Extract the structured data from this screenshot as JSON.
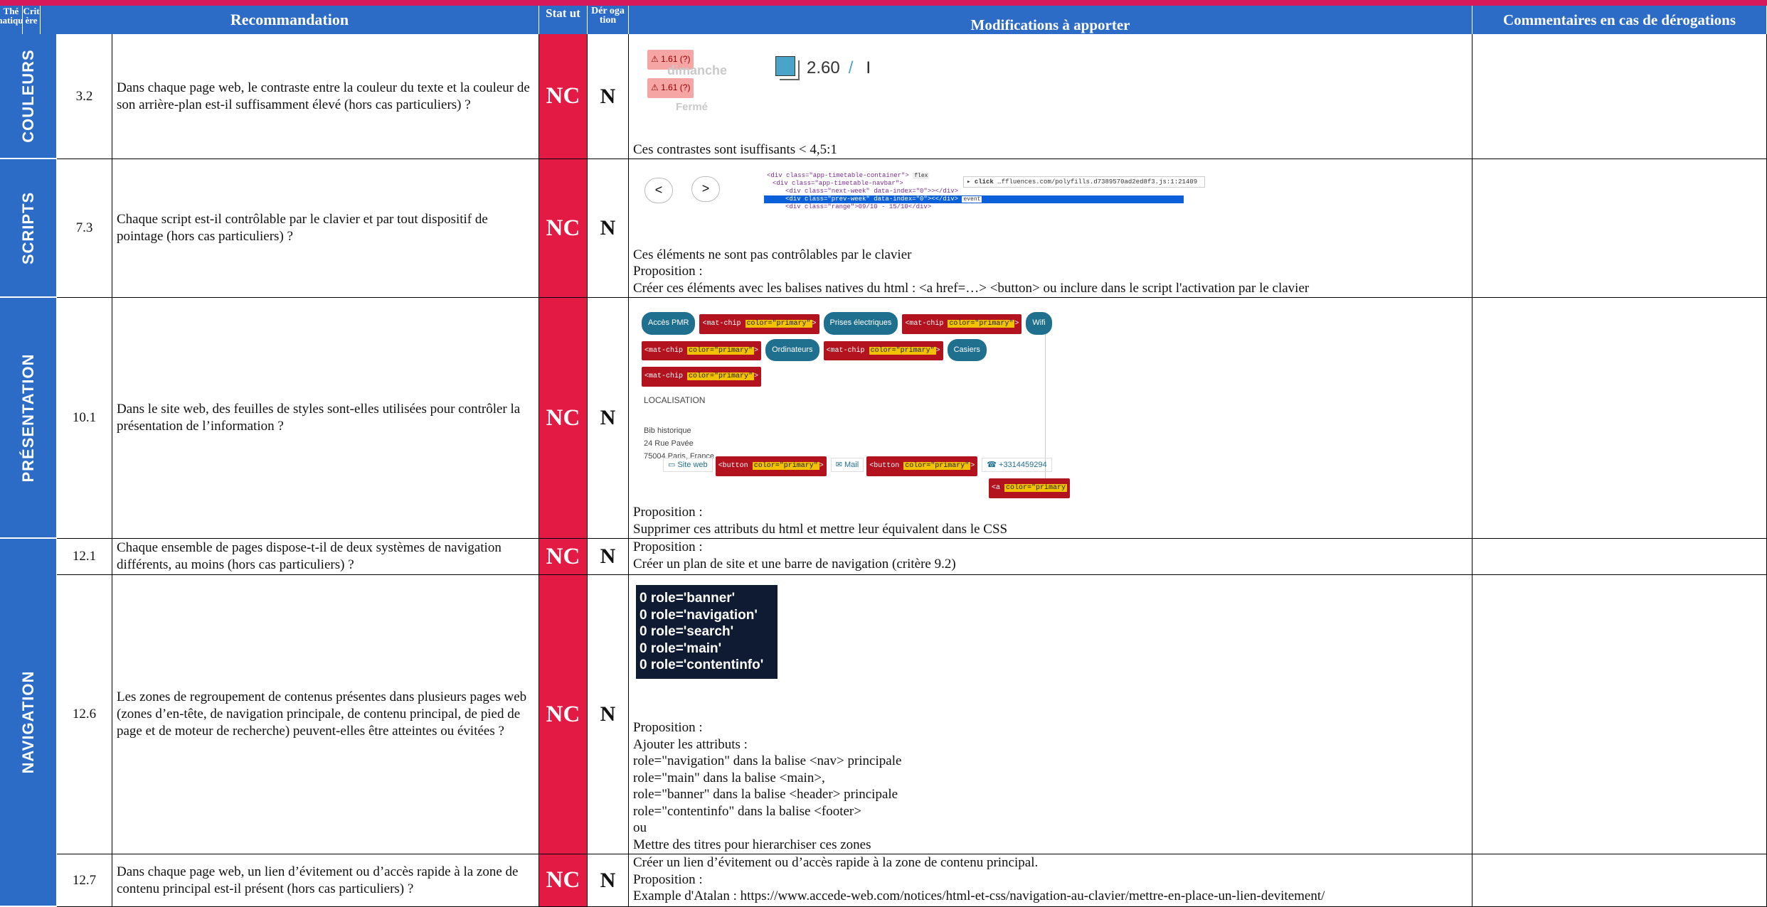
{
  "header": {
    "theme": "Thé matique",
    "critere": "Crit ère",
    "recommandation": "Recommandation",
    "statut": "Stat ut",
    "derogation": "Dér oga tion",
    "modifications": "Modifications à apporter",
    "commentaires": "Commentaires en cas de dérogations"
  },
  "themes": [
    "COULEURS",
    "SCRIPTS",
    "PRÉSENTATION",
    "NAVIGATION"
  ],
  "rows": [
    {
      "critere": "3.2",
      "recommandation": "Dans chaque page web, le contraste entre la couleur du texte et la couleur de son arrière-plan est-il suffisamment élevé (hors cas particuliers) ?",
      "statut": "NC",
      "derogation": "N",
      "modifications": [
        "Ces contrastes sont isuffisants < 4,5:1"
      ]
    },
    {
      "critere": "7.3",
      "recommandation": "Chaque script est-il contrôlable par le clavier et par tout dispositif de pointage (hors cas particuliers) ?",
      "statut": "NC",
      "derogation": "N",
      "modifications": [
        "Ces éléments ne sont pas contrôlables par le clavier",
        "Proposition :",
        "Créer ces éléments avec les balises natives du html : <a href=…> <button> ou inclure dans le script l'activation par le clavier"
      ]
    },
    {
      "critere": "10.1",
      "recommandation": "Dans le site web, des feuilles de styles sont-elles utilisées pour contrôler la présentation de l’information ?",
      "statut": "NC",
      "derogation": "N",
      "modifications": [
        "Proposition :",
        "Supprimer ces attributs du html et mettre leur équivalent dans le CSS"
      ]
    },
    {
      "critere": "12.1",
      "recommandation": "Chaque ensemble de pages dispose-t-il de deux systèmes de navigation différents, au moins (hors cas particuliers) ?",
      "statut": "NC",
      "derogation": "N",
      "modifications": [
        "Proposition :",
        "Créer un plan de site et une barre de navigation (critère 9.2)"
      ]
    },
    {
      "critere": "12.6",
      "recommandation": "Les zones de regroupement de contenus présentes dans plusieurs pages web (zones d’en-tête, de navigation principale, de contenu principal, de pied de page et de moteur de recherche) peuvent-elles être atteintes ou évitées ?",
      "statut": "NC",
      "derogation": "N",
      "modifications": [
        "Proposition :",
        "Ajouter les attributs :",
        "role=\"navigation\" dans la balise <nav> principale",
        "role=\"main\" dans la balise <main>,",
        "role=\"banner\" dans la balise <header> principale",
        "role=\"contentinfo\" dans la balise <footer>",
        "ou",
        "Mettre des titres pour hierarchiser ces zones"
      ]
    },
    {
      "critere": "12.7",
      "recommandation": "Dans chaque page web, un lien d’évitement ou d’accès rapide à la zone de contenu principal est-il présent (hors cas particuliers) ?",
      "statut": "NC",
      "derogation": "N",
      "modifications": [
        "Créer un lien d’évitement ou d’accès rapide à la zone de contenu principal.",
        "Proposition :",
        "Example d'Atalan : https://www.accede-web.com/notices/html-et-css/navigation-au-clavier/mettre-en-place-un-lien-devitement/"
      ]
    }
  ],
  "screenshots": {
    "contrast": {
      "badges": [
        "1.61 (?)",
        "1.61 (?)"
      ],
      "day": "dimanche",
      "status": "Fermé",
      "ratio": "2.60",
      "sep": "/",
      "cursor": "I"
    },
    "scripts": {
      "prev": "<",
      "next": ">",
      "code": [
        "<div class=\"app-timetable-container\">",
        "<div class=\"app-timetable-navbar\">",
        "<div class=\"next-week\" data-index=\"0\">></div>",
        "<div class=\"prev-week\" data-index=\"0\"><</div>",
        "<div class=\"range\">09/10 - 15/10</div>"
      ],
      "flex": "flex",
      "event": "event",
      "click": "click",
      "url": "…ffluences.com/polyfills.d7389570ad2ed8f3.js:1:21409"
    },
    "presentation": {
      "chips": [
        "Accès PMR",
        "Prises électriques",
        "Wifi",
        "Ordinateurs",
        "Casiers"
      ],
      "mat_chip": "<mat-chip",
      "mat_attr": "color=\"primary\"",
      "mat_end": ">",
      "localisation": "LOCALISATION",
      "address": [
        "Bib historique",
        "24 Rue Pavée",
        "75004 Paris, France"
      ],
      "links": [
        "Site web",
        "Mail",
        "+3314459294"
      ],
      "btn": "<button",
      "btn_attr": "color=\"primary\"",
      "a_tag": "<a",
      "a_attr": "color=\"primary"
    },
    "roles": [
      "0 role='banner'",
      "0 role='navigation'",
      "0 role='search'",
      "0 role='main'",
      "0 role='contentinfo'"
    ]
  },
  "colors": {
    "header_blue": "#2d6cc6",
    "status_red": "#e31b44",
    "top_bar": "#d6195a",
    "roles_bg": "#0f1a33"
  }
}
